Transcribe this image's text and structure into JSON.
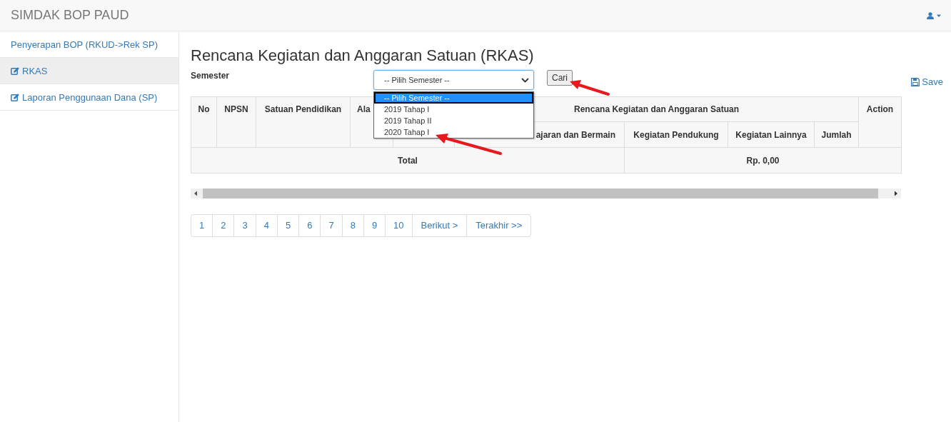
{
  "navbar": {
    "brand": "SIMDAK BOP PAUD"
  },
  "sidebar": {
    "items": [
      {
        "label": "Penyerapan BOP (RKUD->Rek SP)",
        "kind": "plain",
        "selected": false
      },
      {
        "label": "RKAS",
        "kind": "edit",
        "selected": true
      },
      {
        "label": "Laporan Penggunaan Dana (SP)",
        "kind": "edit",
        "selected": false
      }
    ]
  },
  "page": {
    "title": "Rencana Kegiatan dan Anggaran Satuan (RKAS)",
    "semester_label": "Semester",
    "semester_select": {
      "value": "-- Pilih Semester --",
      "expanded": true,
      "options": [
        {
          "label": "-- Pilih Semester --",
          "selected": true
        },
        {
          "label": "2019 Tahap I",
          "selected": false
        },
        {
          "label": "2019 Tahap II",
          "selected": false
        },
        {
          "label": "2020 Tahap I",
          "selected": false
        }
      ]
    },
    "search_button": "Cari",
    "save_link": "Save"
  },
  "table": {
    "columns": [
      "No",
      "NPSN",
      "Satuan Pendidikan",
      "Ala"
    ],
    "group_heading": "Rencana Kegiatan dan Anggaran Satuan",
    "sub_columns": [
      "ajaran dan Bermain",
      "Kegiatan Pendukung",
      "Kegiatan Lainnya",
      "Jumlah"
    ],
    "action_heading": "Action",
    "total": {
      "label": "Total",
      "value": "Rp. 0,00"
    }
  },
  "pagination": [
    "1",
    "2",
    "3",
    "4",
    "5",
    "6",
    "7",
    "8",
    "9",
    "10",
    "Berikut >",
    "Terakhir >>"
  ]
}
